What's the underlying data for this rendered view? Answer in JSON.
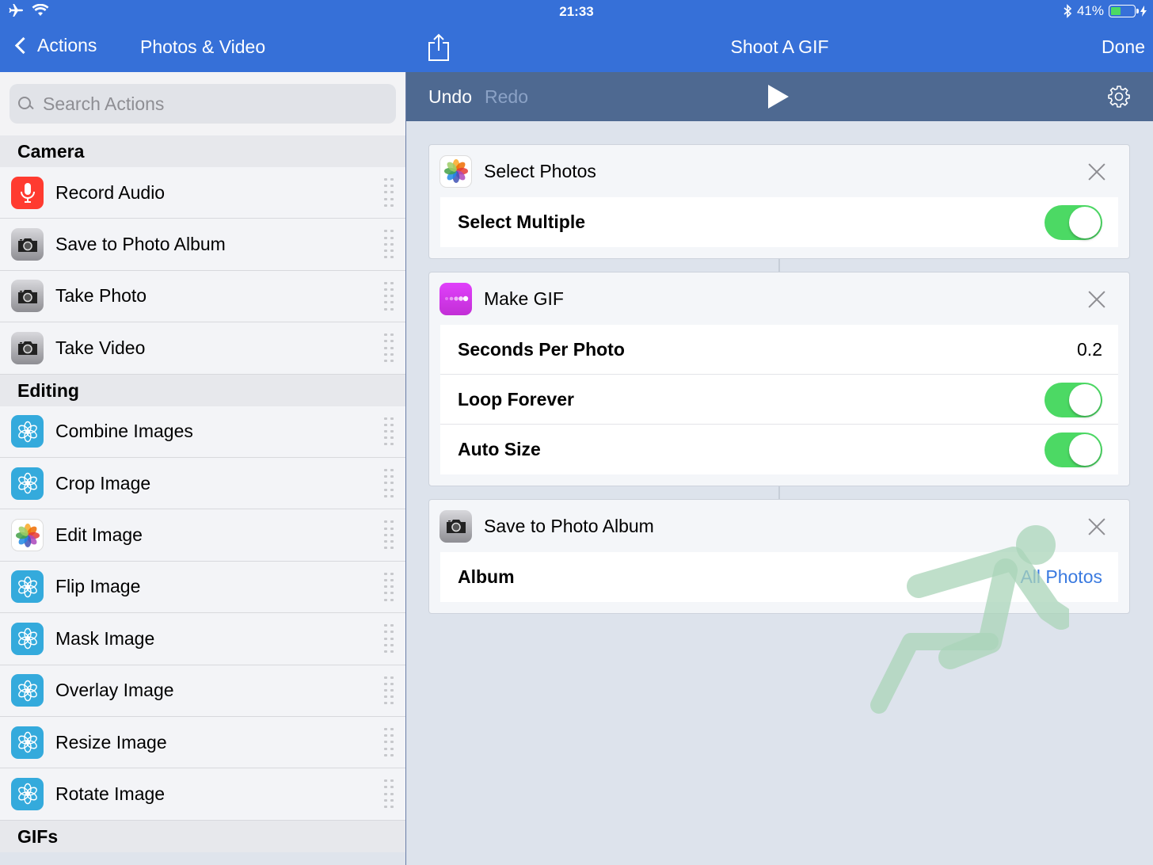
{
  "status_bar": {
    "time": "21:33",
    "battery_text": "41%"
  },
  "left": {
    "back_label": "Actions",
    "title": "Photos & Video",
    "search_placeholder": "Search Actions",
    "sections": [
      {
        "header": "Camera",
        "items": [
          {
            "label": "Record Audio",
            "icon": "microphone-icon"
          },
          {
            "label": "Save to Photo Album",
            "icon": "camera-icon"
          },
          {
            "label": "Take Photo",
            "icon": "camera-icon"
          },
          {
            "label": "Take Video",
            "icon": "camera-icon"
          }
        ]
      },
      {
        "header": "Editing",
        "items": [
          {
            "label": "Combine Images",
            "icon": "image-edit-icon"
          },
          {
            "label": "Crop Image",
            "icon": "image-edit-icon"
          },
          {
            "label": "Edit Image",
            "icon": "photos-flower-icon"
          },
          {
            "label": "Flip Image",
            "icon": "image-edit-icon"
          },
          {
            "label": "Mask Image",
            "icon": "image-edit-icon"
          },
          {
            "label": "Overlay Image",
            "icon": "image-edit-icon"
          },
          {
            "label": "Resize Image",
            "icon": "image-edit-icon"
          },
          {
            "label": "Rotate Image",
            "icon": "image-edit-icon"
          }
        ]
      },
      {
        "header": "GIFs",
        "items": []
      }
    ]
  },
  "right": {
    "title": "Shoot A GIF",
    "done_label": "Done",
    "undo_label": "Undo",
    "redo_label": "Redo",
    "cards": [
      {
        "title": "Select Photos",
        "icon": "photos-flower-icon",
        "params": [
          {
            "label": "Select Multiple",
            "type": "toggle",
            "on": true
          }
        ]
      },
      {
        "title": "Make GIF",
        "icon": "gif-icon",
        "params": [
          {
            "label": "Seconds Per Photo",
            "type": "value",
            "value": "0.2"
          },
          {
            "label": "Loop Forever",
            "type": "toggle",
            "on": true
          },
          {
            "label": "Auto Size",
            "type": "toggle",
            "on": true
          }
        ]
      },
      {
        "title": "Save to Photo Album",
        "icon": "camera-icon",
        "params": [
          {
            "label": "Album",
            "type": "link",
            "value": "All Photos"
          }
        ]
      }
    ]
  },
  "colors": {
    "nav_blue": "#3670d8",
    "toolbar": "#4e6991",
    "toggle_on": "#4cd964",
    "link": "#3a7ae0"
  }
}
